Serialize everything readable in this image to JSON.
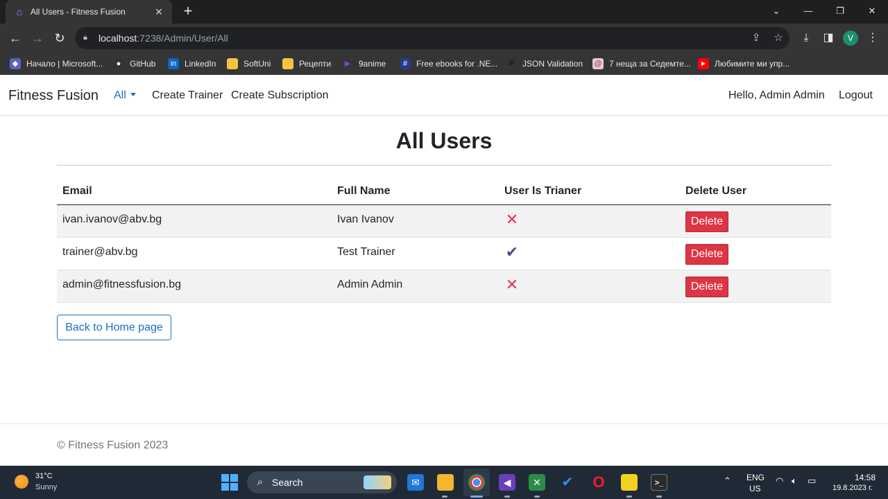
{
  "browser": {
    "tab_title": "All Users - Fitness Fusion",
    "url_host": "localhost",
    "url_path": ":7238/Admin/User/All",
    "profile_initial": "V",
    "bookmarks": [
      {
        "label": "Начало | Microsoft...",
        "color": "#5b5fc7",
        "glyph": "◆"
      },
      {
        "label": "GitHub",
        "color": "#333333",
        "glyph": "●"
      },
      {
        "label": "LinkedIn",
        "color": "#0a66c2",
        "glyph": "in"
      },
      {
        "label": "SoftUni",
        "color": "#f5c342",
        "glyph": ""
      },
      {
        "label": "Рецепти",
        "color": "#f5c342",
        "glyph": ""
      },
      {
        "label": "9anime",
        "color": "#8b3fd9",
        "glyph": "▶"
      },
      {
        "label": "Free ebooks for .NE...",
        "color": "#2a3a8a",
        "glyph": "#"
      },
      {
        "label": "JSON Validation",
        "color": "#3a3a3a",
        "glyph": "JF"
      },
      {
        "label": "7 неща за Седемте...",
        "color": "#e8c9d8",
        "glyph": "@"
      },
      {
        "label": "Любимите ми упр...",
        "color": "#ff0000",
        "glyph": "▶"
      }
    ]
  },
  "navbar": {
    "brand": "Fitness Fusion",
    "all_label": "All",
    "create_trainer": "Create Trainer",
    "create_subscription": "Create Subscription",
    "greeting": "Hello, Admin Admin",
    "logout": "Logout"
  },
  "main": {
    "title": "All Users",
    "columns": [
      "Email",
      "Full Name",
      "User Is Trianer",
      "Delete User"
    ],
    "rows": [
      {
        "email": "ivan.ivanov@abv.bg",
        "full_name": "Ivan Ivanov",
        "is_trainer": false,
        "delete_label": "Delete"
      },
      {
        "email": "trainer@abv.bg",
        "full_name": "Test Trainer",
        "is_trainer": true,
        "delete_label": "Delete"
      },
      {
        "email": "admin@fitnessfusion.bg",
        "full_name": "Admin Admin",
        "is_trainer": false,
        "delete_label": "Delete"
      }
    ],
    "back_button": "Back to Home page"
  },
  "footer": {
    "text": "© Fitness Fusion 2023"
  },
  "taskbar": {
    "temperature": "31°C",
    "condition": "Sunny",
    "search_label": "Search",
    "lang_line1": "ENG",
    "lang_line2": "US",
    "time": "14:58",
    "date": "19.8.2023 г."
  }
}
